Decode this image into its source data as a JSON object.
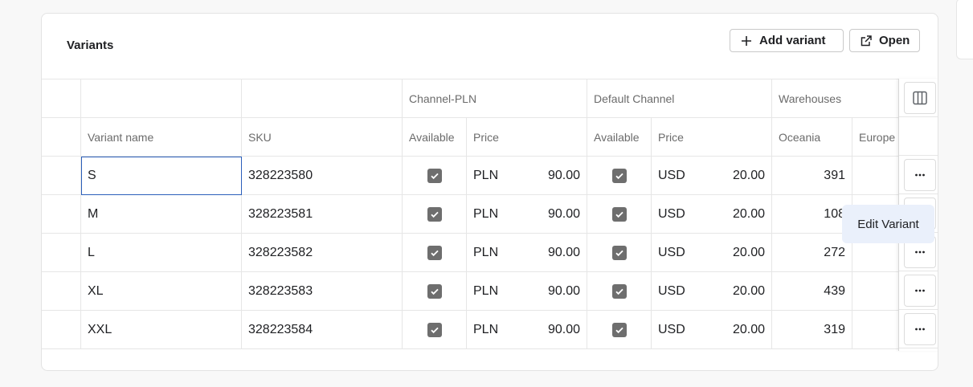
{
  "card": {
    "title": "Variants",
    "add_variant_label": "Add variant",
    "open_label": "Open"
  },
  "table": {
    "group_headers": [
      "Channel-PLN",
      "Default Channel",
      "Warehouses"
    ],
    "column_headers": {
      "variant_name": "Variant name",
      "sku": "SKU",
      "pln_available": "Available",
      "pln_price": "Price",
      "def_available": "Available",
      "def_price": "Price",
      "oceania": "Oceania",
      "europe": "Europe"
    },
    "rows": [
      {
        "name": "S",
        "sku": "328223580",
        "pln_available": true,
        "pln_currency": "PLN",
        "pln_price": "90.00",
        "def_available": true,
        "def_currency": "USD",
        "def_price": "20.00",
        "oceania": "391",
        "europe": ""
      },
      {
        "name": "M",
        "sku": "328223581",
        "pln_available": true,
        "pln_currency": "PLN",
        "pln_price": "90.00",
        "def_available": true,
        "def_currency": "USD",
        "def_price": "20.00",
        "oceania": "108",
        "europe": ""
      },
      {
        "name": "L",
        "sku": "328223582",
        "pln_available": true,
        "pln_currency": "PLN",
        "pln_price": "90.00",
        "def_available": true,
        "def_currency": "USD",
        "def_price": "20.00",
        "oceania": "272",
        "europe": ""
      },
      {
        "name": "XL",
        "sku": "328223583",
        "pln_available": true,
        "pln_currency": "PLN",
        "pln_price": "90.00",
        "def_available": true,
        "def_currency": "USD",
        "def_price": "20.00",
        "oceania": "439",
        "europe": ""
      },
      {
        "name": "XXL",
        "sku": "328223584",
        "pln_available": true,
        "pln_currency": "PLN",
        "pln_price": "90.00",
        "def_available": true,
        "def_currency": "USD",
        "def_price": "20.00",
        "oceania": "319",
        "europe": ""
      }
    ]
  },
  "tooltip": {
    "label": "Edit Variant"
  },
  "icons": {
    "add": "plus-icon",
    "open": "external-link-icon",
    "columns": "columns-icon",
    "row_menu": "more-horizontal-icon",
    "checkbox": "check-icon"
  }
}
